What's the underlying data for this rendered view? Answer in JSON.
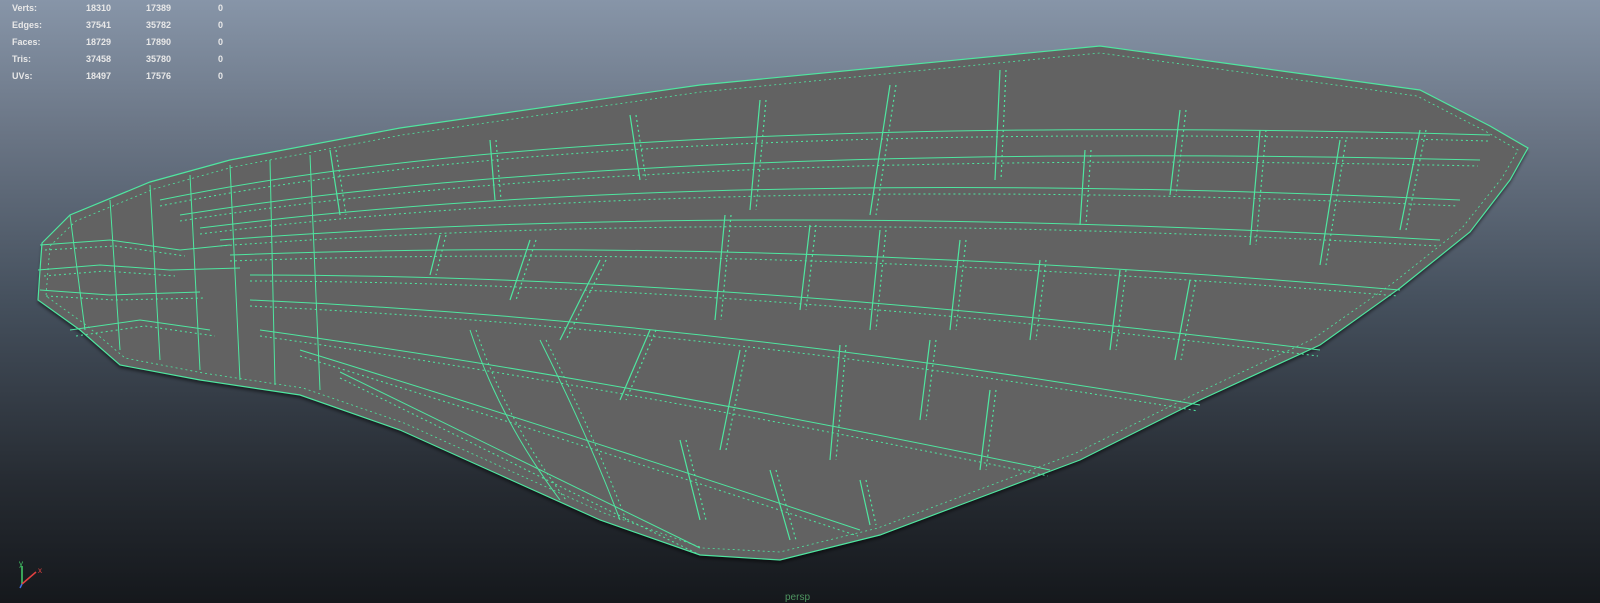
{
  "hud": {
    "rows": [
      {
        "label": "Verts:",
        "v1": "18310",
        "v2": "17389",
        "v3": "0"
      },
      {
        "label": "Edges:",
        "v1": "37541",
        "v2": "35782",
        "v3": "0"
      },
      {
        "label": "Faces:",
        "v1": "18729",
        "v2": "17890",
        "v3": "0"
      },
      {
        "label": "Tris:",
        "v1": "37458",
        "v2": "35780",
        "v3": "0"
      },
      {
        "label": "UVs:",
        "v1": "18497",
        "v2": "17576",
        "v3": "0"
      }
    ]
  },
  "axis": {
    "y_label": "y",
    "x_label": "x"
  },
  "camera": {
    "label": "persp"
  },
  "colors": {
    "wireframe": "#4fe6a0",
    "face": "#626262",
    "bg_top": "#8795a8",
    "bg_bottom": "#15181c"
  }
}
